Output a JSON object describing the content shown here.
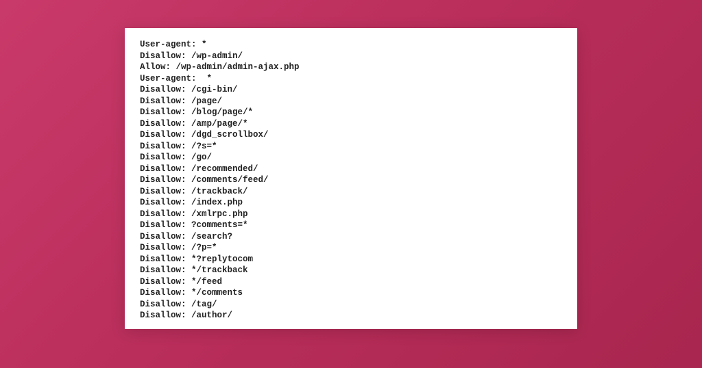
{
  "robots": {
    "lines": [
      "User-agent: *",
      "Disallow: /wp-admin/",
      "Allow: /wp-admin/admin-ajax.php",
      "User-agent:  *",
      "Disallow: /cgi-bin/",
      "Disallow: /page/",
      "Disallow: /blog/page/*",
      "Disallow: /amp/page/*",
      "Disallow: /dgd_scrollbox/",
      "Disallow: /?s=*",
      "Disallow: /go/",
      "Disallow: /recommended/",
      "Disallow: /comments/feed/",
      "Disallow: /trackback/",
      "Disallow: /index.php",
      "Disallow: /xmlrpc.php",
      "Disallow: ?comments=*",
      "Disallow: /search?",
      "Disallow: /?p=*",
      "Disallow: *?replytocom",
      "Disallow: */trackback",
      "Disallow: */feed",
      "Disallow: */comments",
      "Disallow: /tag/",
      "Disallow: /author/"
    ]
  }
}
